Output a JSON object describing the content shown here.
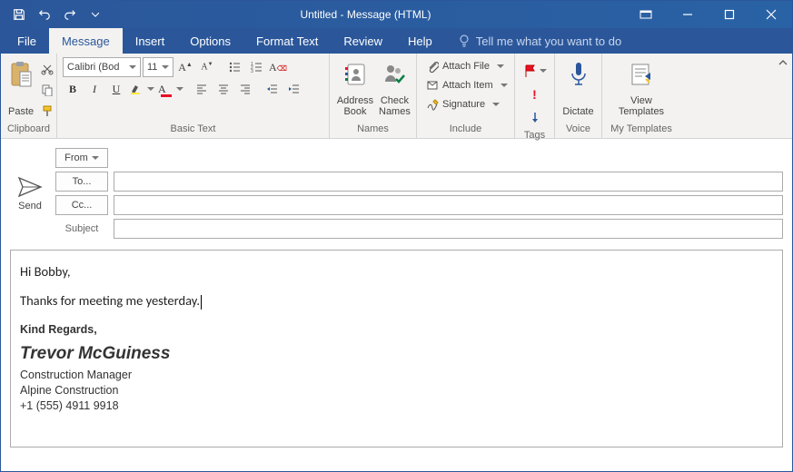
{
  "window": {
    "title": "Untitled  -  Message (HTML)"
  },
  "tabs": {
    "file": "File",
    "message": "Message",
    "insert": "Insert",
    "options": "Options",
    "format_text": "Format Text",
    "review": "Review",
    "help": "Help",
    "tellme": "Tell me what you want to do"
  },
  "ribbon": {
    "clipboard": {
      "label": "Clipboard",
      "paste": "Paste"
    },
    "basic_text": {
      "label": "Basic Text",
      "font": "Calibri (Bod",
      "size": "11",
      "bold": "B",
      "italic": "I",
      "underline": "U"
    },
    "names": {
      "label": "Names",
      "address_book": "Address\nBook",
      "check_names": "Check\nNames"
    },
    "include": {
      "label": "Include",
      "attach_file": "Attach File",
      "attach_item": "Attach Item",
      "signature": "Signature"
    },
    "tags": {
      "label": "Tags"
    },
    "voice": {
      "label": "Voice",
      "dictate": "Dictate"
    },
    "mytemplates": {
      "label": "My Templates",
      "view_templates": "View\nTemplates"
    }
  },
  "compose": {
    "send": "Send",
    "from_label": "From",
    "from_value": "",
    "to_label": "To...",
    "cc_label": "Cc...",
    "subject_label": "Subject",
    "to_value": "",
    "cc_value": "",
    "subject_value": ""
  },
  "body": {
    "line1": "Hi Bobby,",
    "line2": "Thanks for meeting me yesterday.",
    "sig_regards": "Kind Regards,",
    "sig_name": "Trevor McGuiness",
    "sig_title": "Construction Manager",
    "sig_company": "Alpine Construction",
    "sig_phone": "+1 (555) 4911 9918"
  }
}
